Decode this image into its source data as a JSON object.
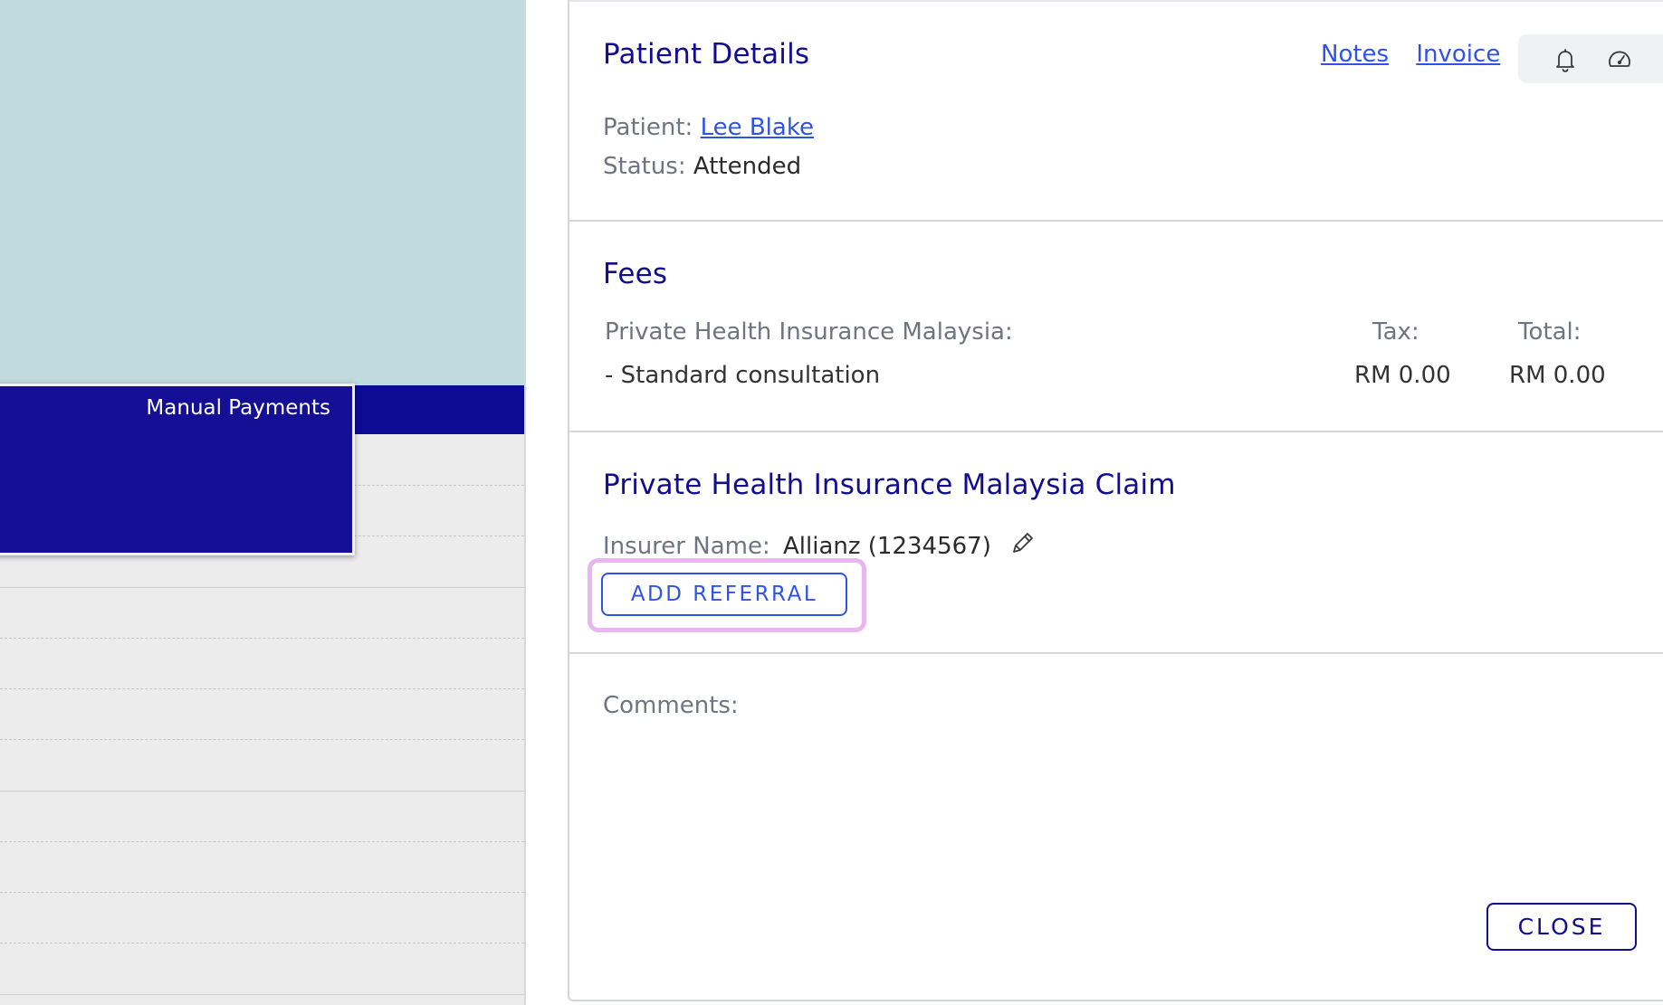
{
  "calendar": {
    "appointment_title": "Manual Payments"
  },
  "patient_details": {
    "title": "Patient Details",
    "links": {
      "notes": "Notes",
      "invoice": "Invoice"
    },
    "patient_label": "Patient:",
    "patient_name": "Lee Blake",
    "status_label": "Status:",
    "status_value": "Attended",
    "icons": [
      "bell-icon",
      "speedometer-icon"
    ]
  },
  "fees": {
    "title": "Fees",
    "insurer_heading": "Private Health Insurance Malaysia:",
    "tax_label": "Tax:",
    "total_label": "Total:",
    "item": "- Standard consultation",
    "tax_value": "RM 0.00",
    "total_value": "RM 0.00"
  },
  "claim": {
    "title": "Private Health Insurance Malaysia Claim",
    "insurer_label": "Insurer Name:",
    "insurer_value": "Allianz (1234567)",
    "add_referral_label": "ADD REFERRAL"
  },
  "comments": {
    "label": "Comments:"
  },
  "footer": {
    "close_label": "CLOSE"
  },
  "colors": {
    "primary_navy": "#120c8f",
    "link_blue": "#2e54e6",
    "highlight_pink": "#e9b6f1",
    "calendar_teal": "#c1dadd"
  }
}
